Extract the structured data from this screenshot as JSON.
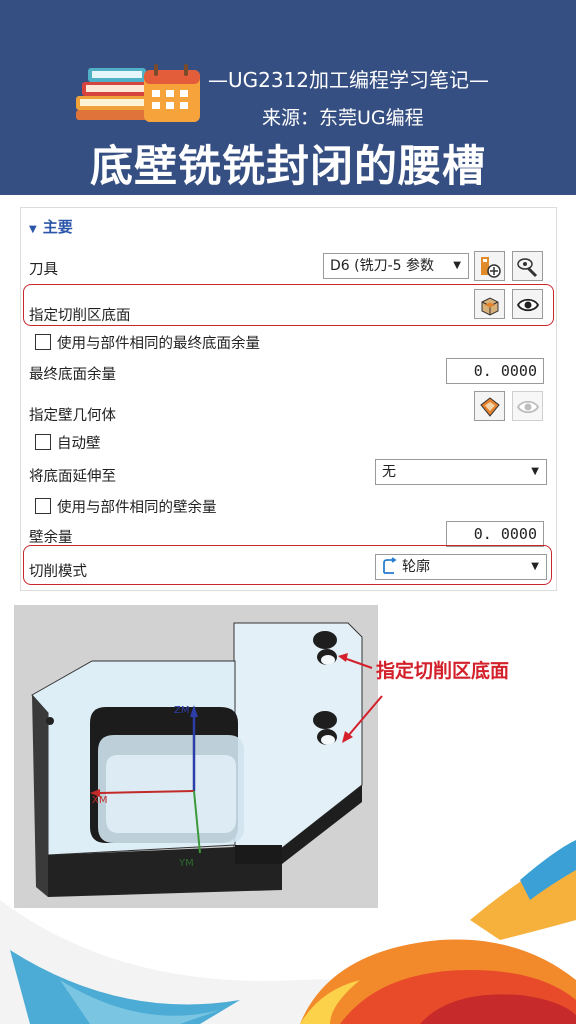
{
  "header": {
    "subtitle": "—UG2312加工编程学习笔记—",
    "source": "来源：东莞UG编程",
    "title": "底壁铣铣封闭的腰槽"
  },
  "dialog": {
    "section_label": "主要",
    "tool_label": "刀具",
    "tool_value": "D6 (铣刀-5 参数",
    "cut_area_label": "指定切削区底面",
    "same_floor_stock_label": "使用与部件相同的最终底面余量",
    "floor_stock_label": "最终底面余量",
    "floor_stock_value": "0. 0000",
    "wall_geometry_label": "指定壁几何体",
    "auto_wall_label": "自动壁",
    "extend_floor_label": "将底面延伸至",
    "extend_floor_value": "无",
    "same_wall_stock_label": "使用与部件相同的壁余量",
    "wall_stock_label": "壁余量",
    "wall_stock_value": "0. 0000",
    "cut_pattern_label": "切削模式",
    "cut_pattern_value": "轮廓"
  },
  "viewport": {
    "axis_z": "ZM",
    "axis_x": "XM",
    "axis_y": "YM",
    "callout": "指定切削区底面"
  },
  "colors": {
    "banner": "#364f82",
    "highlight": "#c8272c",
    "accent_blue": "#2a55a8"
  }
}
